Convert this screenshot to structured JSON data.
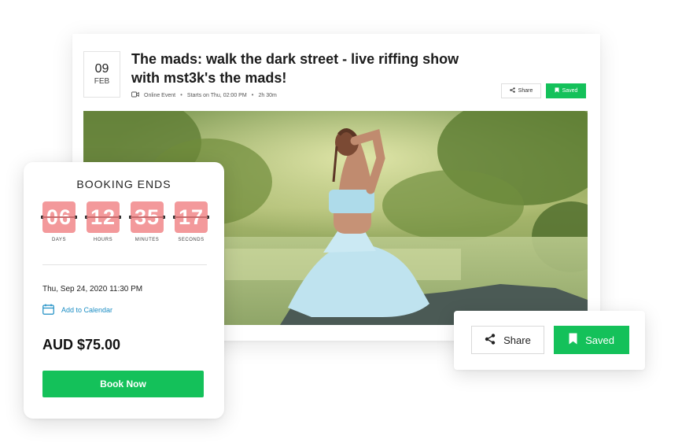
{
  "event": {
    "date_day": "09",
    "date_month": "FEB",
    "title": "The mads: walk the dark street - live riffing show with mst3k's the mads!",
    "type": "Online Event",
    "starts": "Starts on Thu, 02:00 PM",
    "duration": "2h 30m",
    "share_label": "Share",
    "saved_label": "Saved",
    "image_icon": "yoga-photo"
  },
  "booking": {
    "title": "BOOKING ENDS",
    "countdown": [
      {
        "value": "06",
        "label": "DAYS"
      },
      {
        "value": "12",
        "label": "HOURS"
      },
      {
        "value": "35",
        "label": "MINUTES"
      },
      {
        "value": "17",
        "label": "SECONDS"
      }
    ],
    "date": "Thu, Sep 24, 2020 11:30 PM",
    "calendar_label": "Add to Calendar",
    "price": "AUD $75.00",
    "book_label": "Book Now"
  },
  "share_card": {
    "share_label": "Share",
    "saved_label": "Saved"
  },
  "colors": {
    "accent_green": "#14c15a",
    "timer_pink": "#f3999b",
    "link_blue": "#1b8dc4"
  }
}
